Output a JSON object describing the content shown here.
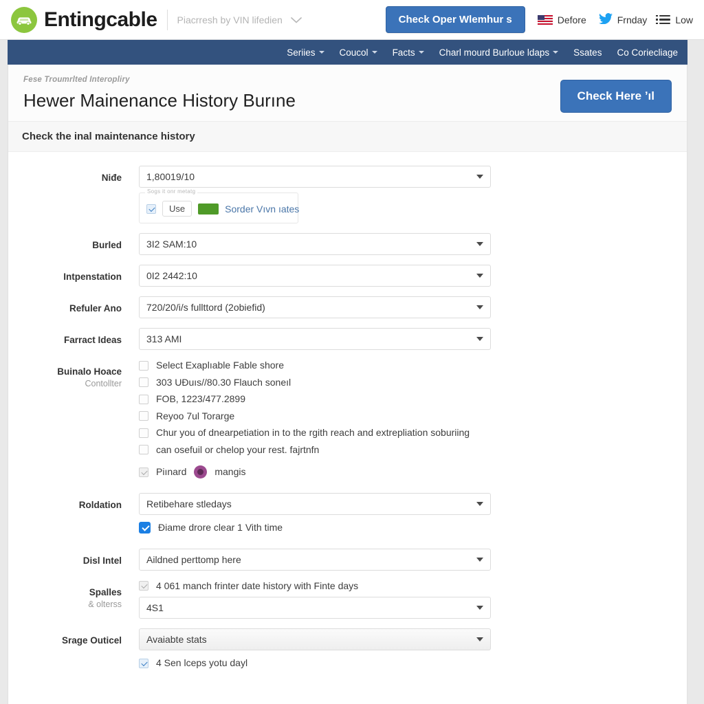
{
  "topbar": {
    "brand": "Entingcable",
    "logo_icon": "car-circle-logo",
    "vin_search": "Piacrresh by VIN lifedien",
    "chevron_icon": "chevron-down-icon",
    "primary_button": "Check Oper Wlemhur s",
    "links": [
      {
        "icon": "us-flag-icon",
        "label": "Defore"
      },
      {
        "icon": "twitter-bird-icon",
        "label": "Frnday"
      },
      {
        "icon": "list-menu-icon",
        "label": "Low"
      }
    ]
  },
  "nav": {
    "items": [
      {
        "label": "Seriies",
        "caret": true
      },
      {
        "label": "Coucol",
        "caret": true
      },
      {
        "label": "Facts",
        "caret": true
      },
      {
        "label": "Charl mourd Burloue ldaps",
        "caret": true
      },
      {
        "label": "Ssates",
        "caret": false
      },
      {
        "label": "Co Coriecliage",
        "caret": false
      }
    ]
  },
  "header": {
    "breadcrumb": "Fese Troumrlted Interopliry",
    "title": "Hewer Mainenance History Burıne",
    "action_button": "Check Here ʼıl",
    "subtitle": "Check the inal maintenance history"
  },
  "form": {
    "rows": {
      "nide": {
        "label": "Niđe",
        "value": "1,80019/10"
      },
      "buried": {
        "label": "Burled",
        "value": "3I2 SAM:10"
      },
      "intpenstation": {
        "label": "Intpenstation",
        "value": "0I2 2442:10"
      },
      "refuler": {
        "label": "Refuler Ano",
        "value": "720/20/i/s fullttord (2obiefid)"
      },
      "farract": {
        "label": "Farract Ideas",
        "value": "313 AMI"
      },
      "roldation": {
        "label": "Roldation",
        "value": "Retibehare stledays"
      },
      "dislintel": {
        "label": "Disl Intel",
        "value": "Aildned perttomp here"
      },
      "spalles_select": {
        "value": "4S1"
      },
      "srage": {
        "label": "Srage Outicel",
        "value": "Avaiabte stats"
      }
    },
    "panel": {
      "legend": "Sogs it onr metatg",
      "checkbox_name": "panel-checkbox",
      "button": "Use",
      "swatch_color": "#4f9a28",
      "link": "Sorder Vıvn ıates"
    },
    "checkgroup": {
      "label": "Buinalo Hoace",
      "sublabel": "Contollter",
      "items": [
        "Select Exaplıable Fable shore",
        "303 UƉuıs//80.30 Flauch soneıl",
        "FOB, 1223/477.2899",
        "Reyoo 7ul Torarge",
        "Chur you of dnearpetiation in to the rgith reach and extrepliation soburiing",
        "can osefuil or chelop your rest. fajrtnfn"
      ],
      "footer_check": "Piınard",
      "footer_badge": "mangis"
    },
    "roldation_check": "Ɖiame drore clear 1 Vith time",
    "spalles": {
      "label": "Spalles",
      "sublabel": "& olterss",
      "check": "4 061 manch frinter date history with Finte days"
    },
    "srage_check": "4 Sen lceps yotu dayl"
  },
  "colors": {
    "brand_green": "#8cc63e",
    "nav_blue": "#33527e",
    "button_blue": "#3b73b9",
    "checked_blue": "#1b7fe3",
    "badge_purple": "#9c4a8f"
  }
}
